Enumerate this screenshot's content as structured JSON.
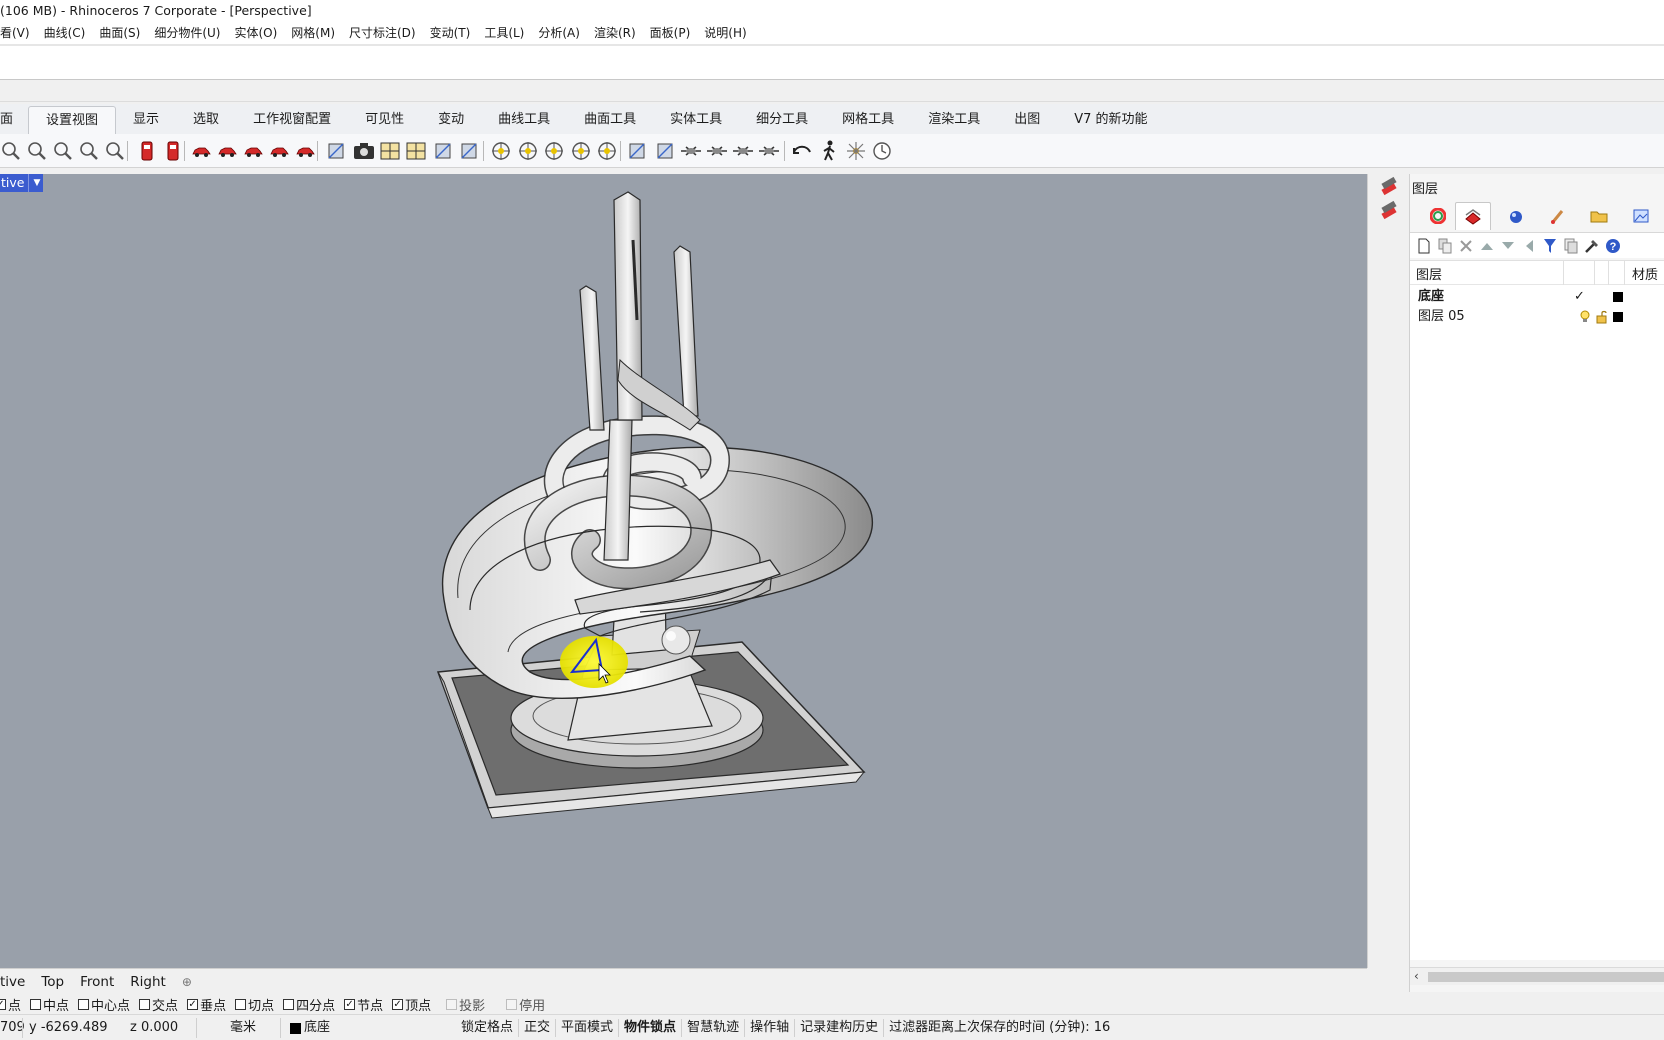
{
  "app": {
    "title": "(106 MB) - Rhinoceros 7 Corporate - [Perspective]"
  },
  "menu": [
    "看(V)",
    "曲线(C)",
    "曲面(S)",
    "细分物件(U)",
    "实体(O)",
    "网格(M)",
    "尺寸标注(D)",
    "变动(T)",
    "工具(L)",
    "分析(A)",
    "渲染(R)",
    "面板(P)",
    "说明(H)"
  ],
  "toolbar_tabs": [
    {
      "label": "面",
      "active": false
    },
    {
      "label": "设置视图",
      "active": true
    },
    {
      "label": "显示",
      "active": false
    },
    {
      "label": "选取",
      "active": false
    },
    {
      "label": "工作视窗配置",
      "active": false
    },
    {
      "label": "可见性",
      "active": false
    },
    {
      "label": "变动",
      "active": false
    },
    {
      "label": "曲线工具",
      "active": false
    },
    {
      "label": "曲面工具",
      "active": false
    },
    {
      "label": "实体工具",
      "active": false
    },
    {
      "label": "细分工具",
      "active": false
    },
    {
      "label": "网格工具",
      "active": false
    },
    {
      "label": "渲染工具",
      "active": false
    },
    {
      "label": "出图",
      "active": false
    },
    {
      "label": "V7 的新功能",
      "active": false
    }
  ],
  "toolbar_icons": [
    "zoom-window-icon",
    "zoom-dynamic-icon",
    "rotate-view-icon",
    "zoom-extents-icon",
    "zoom-1to1-icon",
    "named-view-icon",
    "named-position-icon",
    "car-view-1-icon",
    "car-view-2-icon",
    "car-view-3-icon",
    "car-view-4-icon",
    "car-view-5-icon",
    "copy-view-icon",
    "camera-icon",
    "viewport-properties-icon",
    "four-views-icon",
    "background-bitmap-icon",
    "two-point-perspective-icon",
    "snap-to-grid-icon",
    "cplane-origin-icon",
    "cplane-elevation-icon",
    "cplane-object-icon",
    "cplane-3pt-icon",
    "gumball-align-icon",
    "plane-tools-icon",
    "fly-view-1-icon",
    "fly-view-2-icon",
    "fly-view-3-icon",
    "fly-view-4-icon",
    "undo-view-icon",
    "walkabout-icon",
    "sun-icon",
    "clock-icon"
  ],
  "viewport": {
    "label": "tive"
  },
  "panel": {
    "title": "图层",
    "tab_icons": [
      "color-wheel-icon",
      "layers-icon",
      "material-ball-icon",
      "brush-icon",
      "folder-icon",
      "image-icon"
    ],
    "tool_icons": [
      "new-layer-icon",
      "new-sublayer-icon",
      "delete-icon",
      "move-up-icon",
      "move-down-icon",
      "move-left-icon",
      "filter-icon",
      "copy-layer-icon",
      "tools-icon",
      "help-icon"
    ],
    "columns": {
      "name": "图层",
      "material": "材质"
    },
    "layers": [
      {
        "name": "底座",
        "current": true,
        "checkmark": "✓",
        "color": "#000000",
        "show_icons": false
      },
      {
        "name": "图层 05",
        "current": false,
        "checkmark": "",
        "color": "#000000",
        "show_icons": true
      }
    ]
  },
  "viewport_tabs": [
    "tive",
    "Top",
    "Front",
    "Right"
  ],
  "viewport_tabs_add": "⊕",
  "osnaps": [
    {
      "label": "点",
      "checked": true,
      "disabled": false
    },
    {
      "label": "中点",
      "checked": false,
      "disabled": false
    },
    {
      "label": "中心点",
      "checked": false,
      "disabled": false
    },
    {
      "label": "交点",
      "checked": false,
      "disabled": false
    },
    {
      "label": "垂点",
      "checked": true,
      "disabled": false
    },
    {
      "label": "切点",
      "checked": false,
      "disabled": false
    },
    {
      "label": "四分点",
      "checked": false,
      "disabled": false
    },
    {
      "label": "节点",
      "checked": true,
      "disabled": false
    },
    {
      "label": "顶点",
      "checked": true,
      "disabled": false
    },
    {
      "label": "投影",
      "checked": false,
      "disabled": true
    },
    {
      "label": "停用",
      "checked": false,
      "disabled": true
    }
  ],
  "status": {
    "x": "709",
    "y": "y -6269.489",
    "z": "z 0.000",
    "units": "毫米",
    "layer": "底座",
    "layer_color": "#000000",
    "toggles": [
      {
        "label": "锁定格点",
        "bold": false
      },
      {
        "label": "正交",
        "bold": false
      },
      {
        "label": "平面模式",
        "bold": false
      },
      {
        "label": "物件锁点",
        "bold": true
      },
      {
        "label": "智慧轨迹",
        "bold": false
      },
      {
        "label": "操作轴",
        "bold": false
      },
      {
        "label": "记录建构历史",
        "bold": false
      },
      {
        "label": "过滤器",
        "bold": false
      }
    ],
    "save_time": "距离上次保存的时间 (分钟): 16"
  }
}
